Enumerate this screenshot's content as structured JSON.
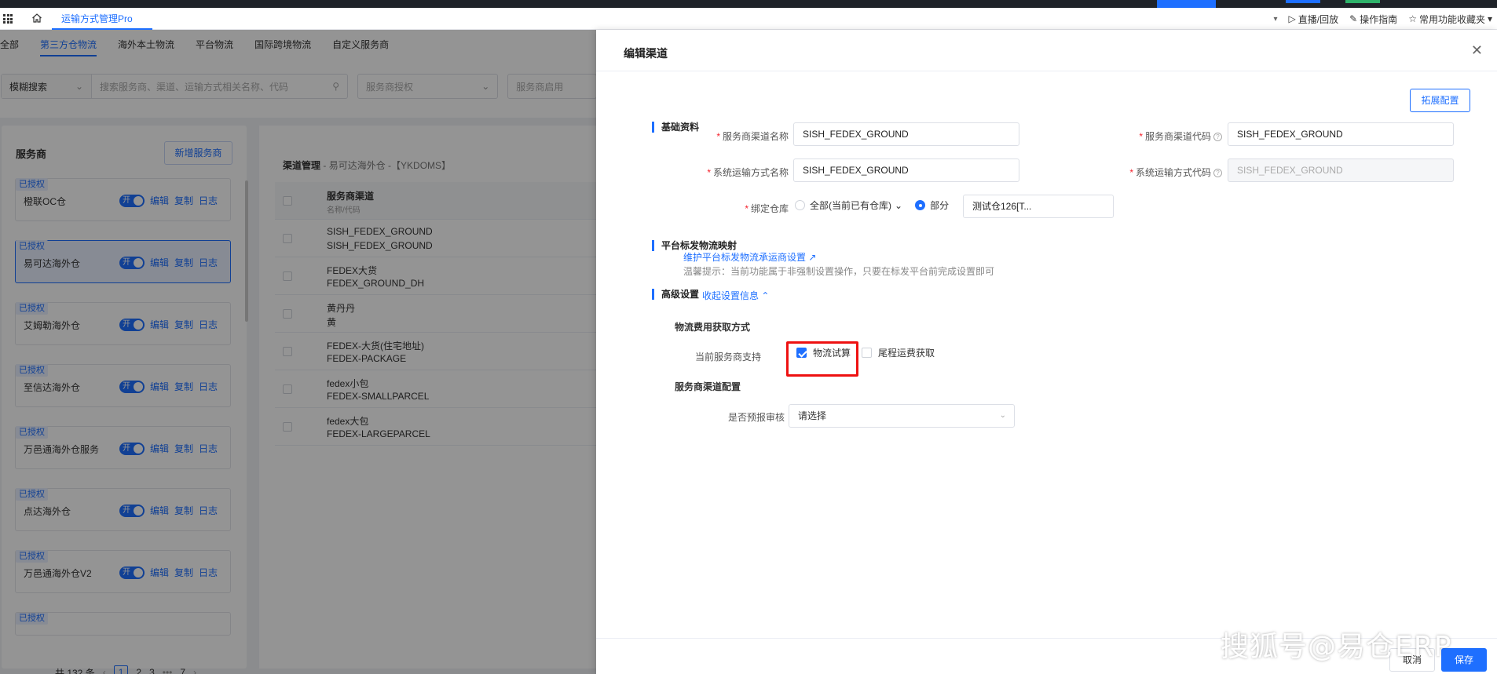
{
  "app": {
    "active_tab": "运输方式管理Pro",
    "right_actions": [
      "直播/回放",
      "操作指南",
      "常用功能收藏夹"
    ]
  },
  "bg": {
    "category_tabs": [
      "全部",
      "第三方仓物流",
      "海外本土物流",
      "平台物流",
      "国际跨境物流",
      "自定义服务商"
    ],
    "active_category": 1,
    "search": {
      "mode": "模糊搜索",
      "placeholder": "搜索服务商、渠道、运输方式相关名称、代码",
      "provider_auth_placeholder": "服务商授权",
      "provider_enable_placeholder": "服务商启用"
    },
    "provider_panel": {
      "title": "服务商",
      "add_button": "新增服务商",
      "auth_badge": "已授权",
      "switch_label": "开",
      "ops": [
        "编辑",
        "复制",
        "日志"
      ],
      "items": [
        {
          "name": "橙联OC仓"
        },
        {
          "name": "易可达海外仓"
        },
        {
          "name": "艾姆勒海外仓"
        },
        {
          "name": "至信达海外仓"
        },
        {
          "name": "万邑通海外仓服务"
        },
        {
          "name": "点达海外仓"
        },
        {
          "name": "万邑通海外仓V2"
        }
      ],
      "selected_index": 1,
      "pager": {
        "total": "共 132 条",
        "pages": [
          "1",
          "2",
          "3",
          "•••",
          "7"
        ],
        "current": "1"
      }
    },
    "channel_panel": {
      "title": "渠道管理",
      "subtitle": "- 易可达海外仓 -【YKDOMS】",
      "header": {
        "col": "服务商渠道",
        "sub": "名称/代码"
      },
      "rows": [
        {
          "name": "SISH_FEDEX_GROUND",
          "code": "SISH_FEDEX_GROUND"
        },
        {
          "name": "FEDEX大货",
          "code": "FEDEX_GROUND_DH"
        },
        {
          "name": "黄丹丹",
          "code": "黄"
        },
        {
          "name": "FEDEX-大货(住宅地址)",
          "code": "FEDEX-PACKAGE"
        },
        {
          "name": "fedex小包",
          "code": "FEDEX-SMALLPARCEL"
        },
        {
          "name": "fedex大包",
          "code": "FEDEX-LARGEPARCEL"
        }
      ]
    }
  },
  "drawer": {
    "title": "编辑渠道",
    "basic_section": "基础资料",
    "expand_button": "拓展配置",
    "fields": {
      "provider_channel_name": {
        "label": "服务商渠道名称",
        "value": "SISH_FEDEX_GROUND"
      },
      "provider_channel_code": {
        "label": "服务商渠道代码",
        "value": "SISH_FEDEX_GROUND"
      },
      "system_method_name": {
        "label": "系统运输方式名称",
        "value": "SISH_FEDEX_GROUND"
      },
      "system_method_code": {
        "label": "系统运输方式代码",
        "value": "SISH_FEDEX_GROUND"
      },
      "bind_warehouse": {
        "label": "绑定仓库",
        "option_all": "全部(当前已有仓库)",
        "option_part": "部分",
        "selected": "部分",
        "warehouse_tag": "测试仓126[T..."
      }
    },
    "platform_section": "平台标发物流映射",
    "platform_link": "维护平台标发物流承运商设置",
    "platform_tip": "温馨提示：当前功能属于非强制设置操作，只要在标发平台前完成设置即可",
    "advanced_section": "高级设置",
    "collapse_link": "收起设置信息",
    "fee_subhead": "物流费用获取方式",
    "fee_label": "当前服务商支持",
    "fee_options": [
      {
        "label": "物流试算",
        "checked": true
      },
      {
        "label": "尾程运费获取",
        "checked": false
      }
    ],
    "channel_config_subhead": "服务商渠道配置",
    "prereport_label": "是否预报审核",
    "prereport_placeholder": "请选择",
    "cancel": "取消",
    "save": "保存"
  },
  "watermark": "搜狐号@易仓ERP",
  "colors": {
    "primary": "#1e6fff",
    "danger": "#ee1111",
    "required": "#f5222d"
  }
}
